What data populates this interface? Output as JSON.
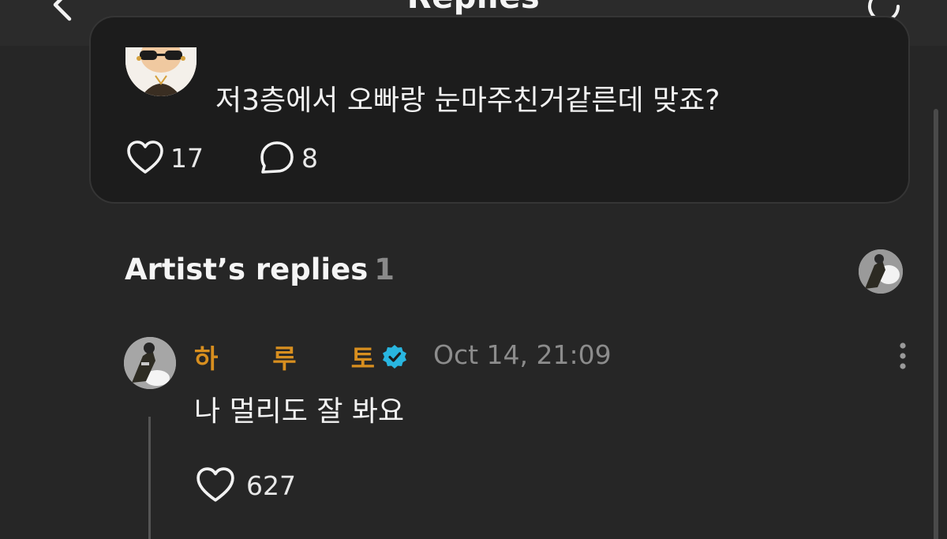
{
  "header": {
    "title": "Replies",
    "back_icon": "chevron-left-icon",
    "refresh_icon": "refresh-icon"
  },
  "post": {
    "text": "저3층에서 오빠랑 눈마주친거같른데 맞죠?",
    "like_count": "17",
    "comment_count": "8"
  },
  "artist_replies": {
    "title": "Artist’s replies",
    "count": "1",
    "reply": {
      "name": "하      루      토",
      "date": "Oct 14, 21:09",
      "text": "나 멀리도 잘 봐요",
      "like_count": "627",
      "verified_color": "#29b6e0"
    }
  },
  "colors": {
    "background": "#262626",
    "card": "#1c1c1c",
    "accent_name": "#d88f1f",
    "muted": "#8c8c8c"
  }
}
